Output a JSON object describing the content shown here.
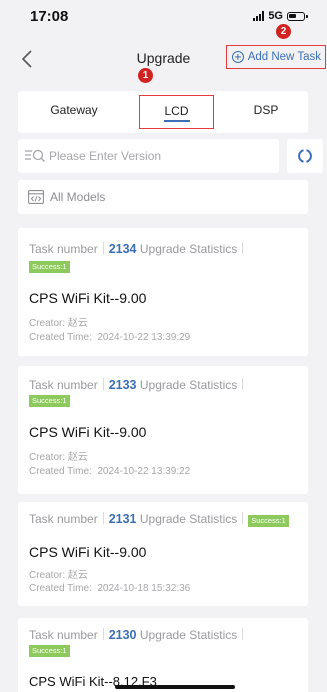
{
  "status_bar": {
    "time": "17:08",
    "network": "5G"
  },
  "nav": {
    "title": "Upgrade",
    "add_task_label": "Add New Task"
  },
  "markers": [
    "1",
    "2"
  ],
  "tabs": [
    {
      "label": "Gateway"
    },
    {
      "label": "LCD",
      "selected": true
    },
    {
      "label": "DSP"
    }
  ],
  "search": {
    "placeholder": "Please Enter Version"
  },
  "model_filter": {
    "label": "All Models"
  },
  "labels": {
    "task_number": "Task number",
    "upgrade_statistics": "Upgrade Statistics",
    "creator": "Creator:",
    "created_time": "Created Time:"
  },
  "tasks": [
    {
      "number": "2134",
      "status": "Success:1",
      "name": "CPS WiFi Kit--9.00",
      "creator": "赵云",
      "created": "2024-10-22 13:39:29"
    },
    {
      "number": "2133",
      "status": "Success:1",
      "name": "CPS WiFi Kit--9.00",
      "creator": "赵云",
      "created": "2024-10-22 13:39:22"
    },
    {
      "number": "2131",
      "status": "Success:1",
      "name": "CPS WiFi Kit--9.00",
      "creator": "赵云",
      "created": "2024-10-18 15:32:36"
    },
    {
      "number": "2130",
      "status": "Success:1",
      "name": "CPS WiFi Kit--8.12.F3"
    }
  ],
  "colors": {
    "accent": "#3c6fb5",
    "highlight_box": "#e03a3a",
    "success": "#8dc95c",
    "marker": "#d32222",
    "background": "#f2f2f4"
  }
}
